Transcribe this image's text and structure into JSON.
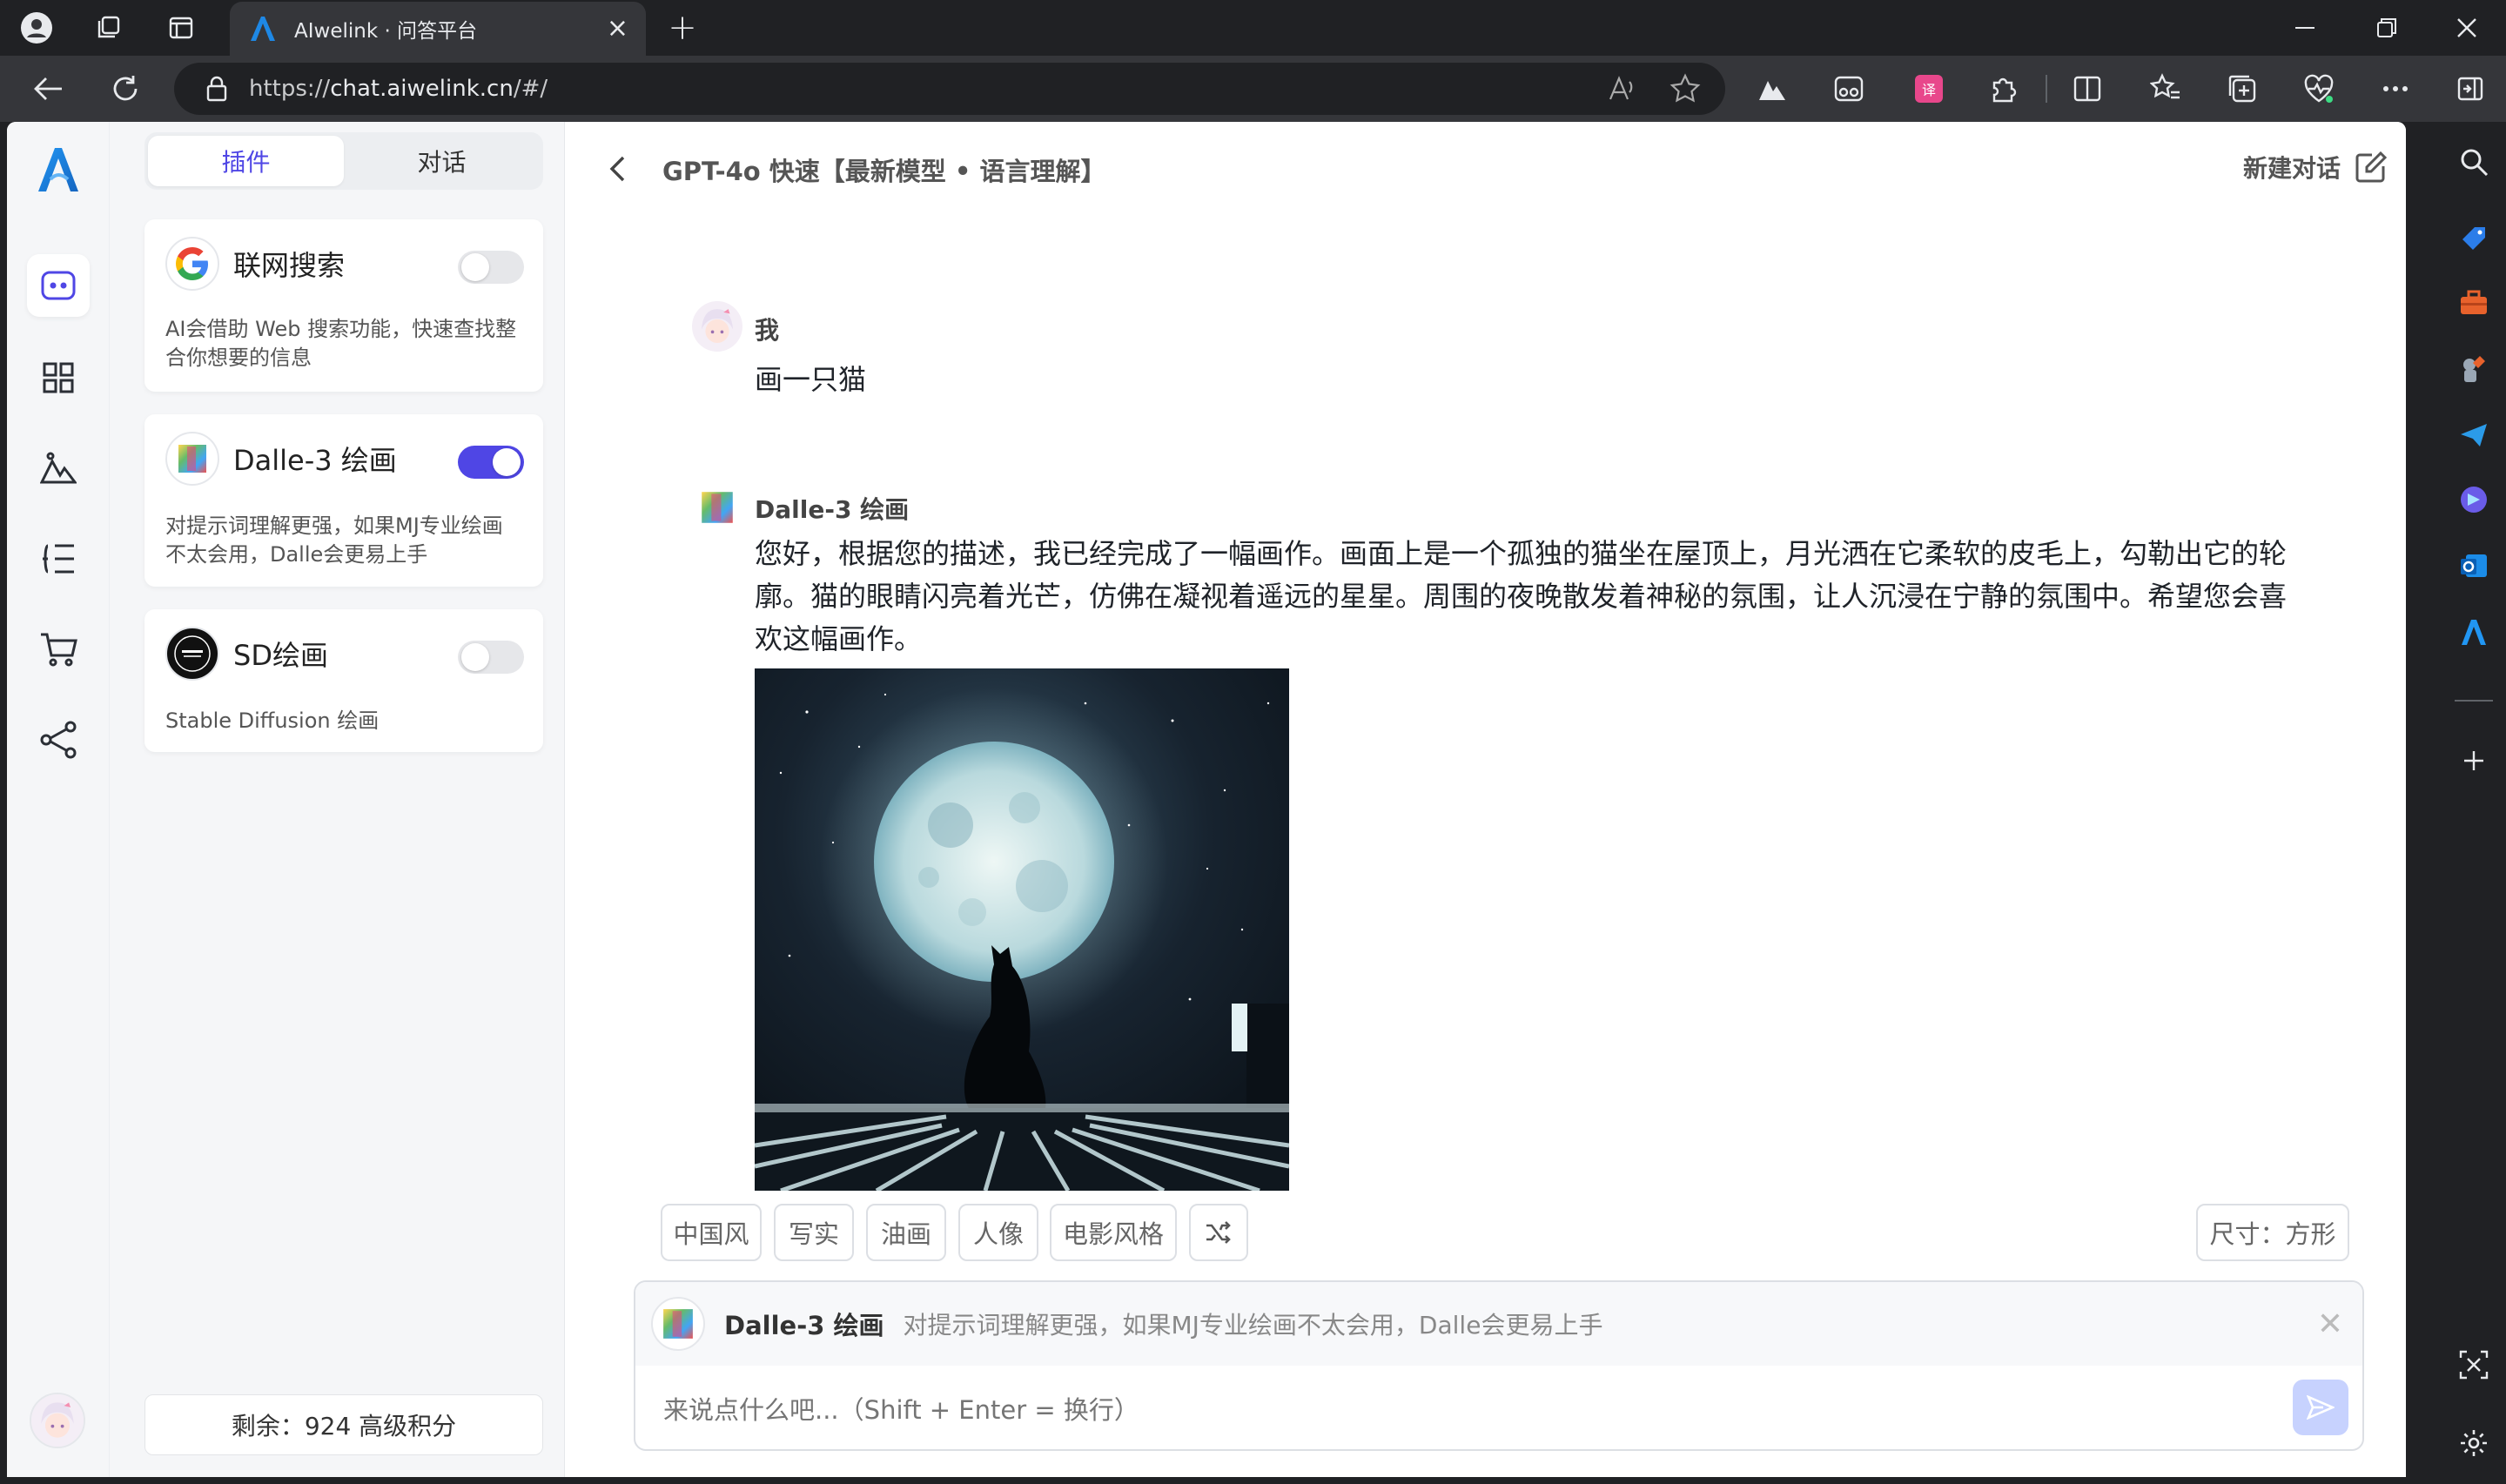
{
  "browser": {
    "tab_title": "AIwelink · 问答平台",
    "url_prefix": "https://",
    "url_host": "chat.aiwelink.cn",
    "url_path": "/#/"
  },
  "sidebar": {
    "segments": [
      "插件",
      "对话"
    ],
    "active_segment": "插件"
  },
  "plugins": [
    {
      "name": "联网搜索",
      "desc": "AI会借助 Web 搜索功能，快速查找整合你想要的信息",
      "enabled": false,
      "icon": "google-logo"
    },
    {
      "name": "Dalle-3 绘画",
      "desc": "对提示词理解更强，如果MJ专业绘画不太会用，Dalle会更易上手",
      "enabled": true,
      "icon": "dalle-logo"
    },
    {
      "name": "SD绘画",
      "desc": "Stable Diffusion 绘画",
      "enabled": false,
      "icon": "sd-logo"
    }
  ],
  "credits": "剩余：924 高级积分",
  "chat": {
    "title": "GPT-4o 快速【最新模型 • 语言理解】",
    "new_chat": "新建对话",
    "messages": [
      {
        "sender": "我",
        "text": "画一只猫"
      },
      {
        "sender": "Dalle-3 绘画",
        "text": "您好，根据您的描述，我已经完成了一幅画作。画面上是一个孤独的猫坐在屋顶上，月光洒在它柔软的皮毛上，勾勒出它的轮廓。猫的眼睛闪亮着光芒，仿佛在凝视着遥远的星星。周围的夜晚散发着神秘的氛围，让人沉浸在宁静的氛围中。希望您会喜欢这幅画作。"
      }
    ],
    "style_chips": [
      "中国风",
      "写实",
      "油画",
      "人像",
      "电影风格"
    ],
    "size_label": "尺寸：方形",
    "active_plugin_name": "Dalle-3 绘画",
    "active_plugin_desc": "对提示词理解更强，如果MJ专业绘画不太会用，Dalle会更易上手",
    "input_placeholder": "来说点什么吧...（Shift + Enter = 换行）"
  },
  "colors": {
    "accent": "#4f46e5",
    "brand": "#1e88e5"
  }
}
